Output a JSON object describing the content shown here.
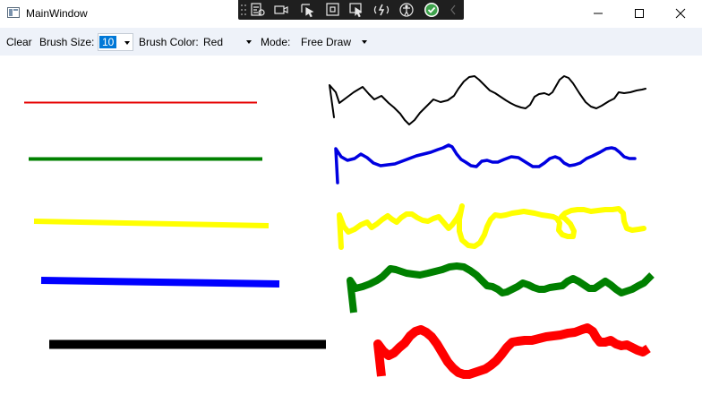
{
  "window": {
    "title": "MainWindow",
    "icons": {
      "app": "window-app-icon",
      "minimize": "minimize-icon",
      "maximize": "maximize-icon",
      "close": "close-icon"
    }
  },
  "debug_toolbar": {
    "icons": [
      "grip-icon",
      "live-visual-tree-icon",
      "record-icon",
      "select-element-icon",
      "display-layout-adorners-icon",
      "track-focus-icon",
      "hot-reload-icon",
      "accessibility-icon",
      "checkmark-icon",
      "collapse-chevron-icon"
    ]
  },
  "toolbar": {
    "clear_label": "Clear",
    "brush_size_label": "Brush Size:",
    "brush_size_value": "10",
    "brush_color_label": "Brush Color:",
    "brush_color_value": "Red",
    "mode_label": "Mode:",
    "mode_value": "Free Draw"
  },
  "canvas": {
    "strokes": [
      {
        "kind": "straight-line",
        "color": "#e60000"
      },
      {
        "kind": "straight-line",
        "color": "#008000"
      },
      {
        "kind": "straight-line",
        "color": "#ffff00"
      },
      {
        "kind": "straight-line",
        "color": "#0000ff"
      },
      {
        "kind": "straight-line",
        "color": "#000000"
      },
      {
        "kind": "freehand",
        "color": "#000000"
      },
      {
        "kind": "freehand",
        "color": "#0000e0"
      },
      {
        "kind": "freehand",
        "color": "#ffff00"
      },
      {
        "kind": "freehand",
        "color": "#008000"
      },
      {
        "kind": "freehand",
        "color": "#ff0000"
      }
    ]
  }
}
